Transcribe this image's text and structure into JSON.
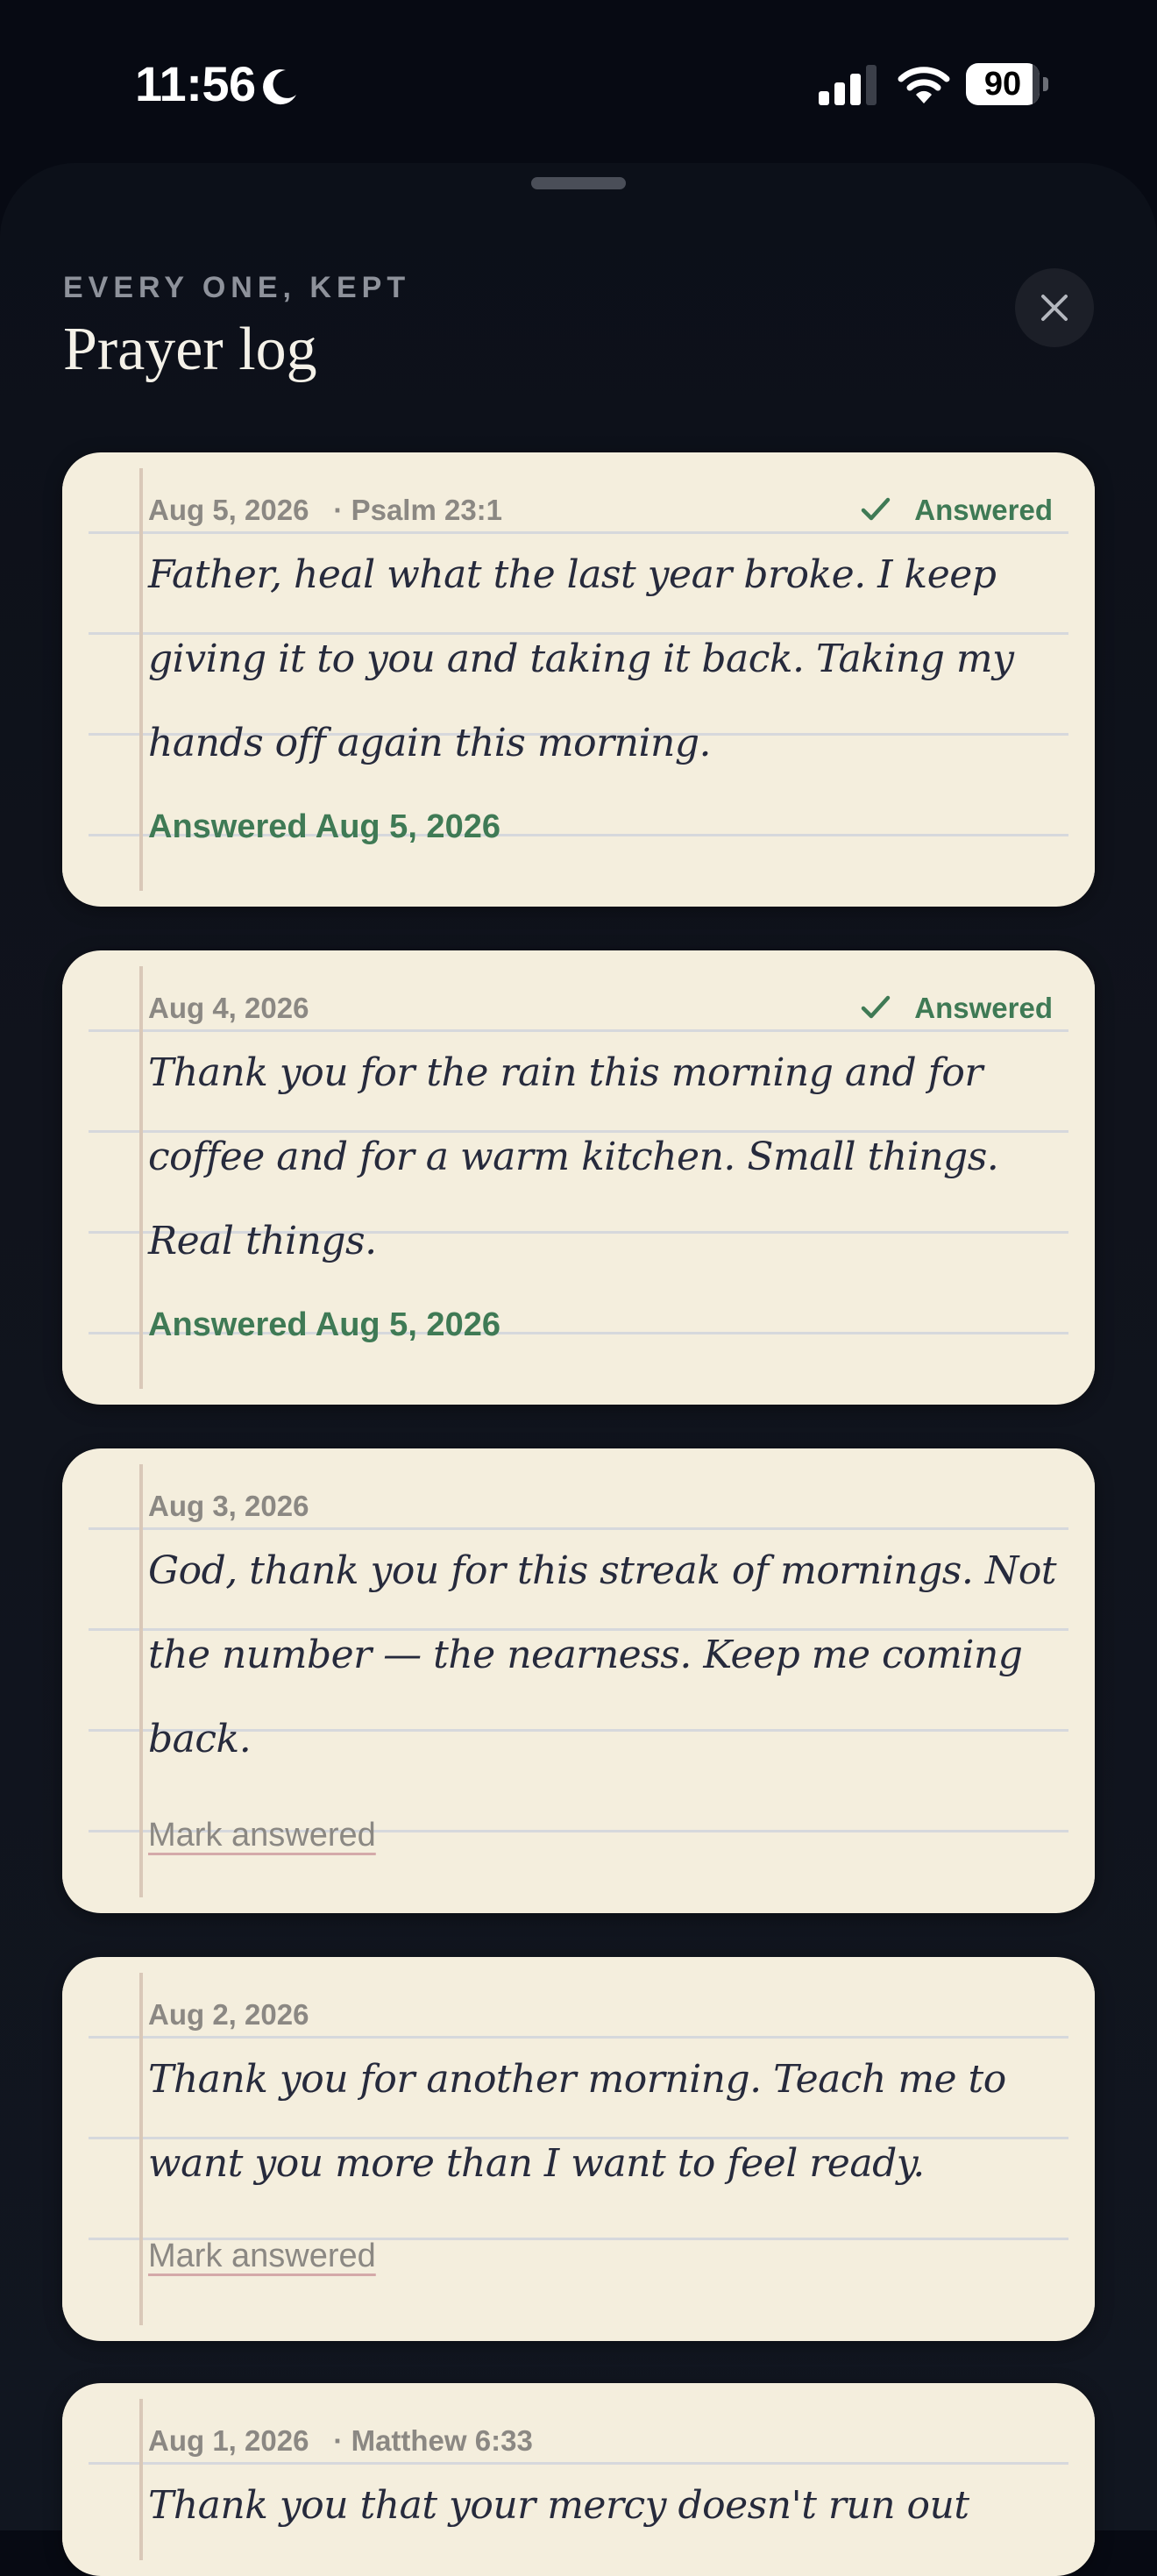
{
  "status_bar": {
    "time": "11:56",
    "battery": "90",
    "battery_level": 0.9
  },
  "sheet": {
    "eyebrow": "EVERY ONE, KEPT",
    "title": "Prayer log"
  },
  "prayers": [
    {
      "date": "Aug 5, 2026",
      "reference": "· Psalm 23:1",
      "status": "Answered",
      "text": "Father, heal what the last year broke. I keep giving it to you and taking it back. Taking my hands off again this morning.",
      "footer": "Answered Aug 5, 2026"
    },
    {
      "date": "Aug 4, 2026",
      "status": "Answered",
      "text": "Thank you for the rain this morning and for coffee and for a warm kitchen. Small things. Real things.",
      "footer": "Answered Aug 5, 2026"
    },
    {
      "date": "Aug 3, 2026",
      "text": "God, thank you for this streak of mornings. Not the number — the nearness. Keep me coming back.",
      "action": "Mark answered"
    },
    {
      "date": "Aug 2, 2026",
      "text": "Thank you for another morning. Teach me to want you more than I want to feel ready.",
      "action": "Mark answered"
    },
    {
      "date": "Aug 1, 2026",
      "reference": "· Matthew 6:33",
      "text": "Thank you that your mercy doesn't run out"
    }
  ],
  "colors": {
    "background": "#070a13",
    "card": "#f4eedd",
    "answered_green": "#3f7a55",
    "ink": "#262a3c"
  },
  "icons": {
    "close": "close-icon",
    "check": "checkmark-icon",
    "moon": "moon-icon",
    "signal": "cellular-signal-icon",
    "wifi": "wifi-icon",
    "battery": "battery-icon"
  }
}
